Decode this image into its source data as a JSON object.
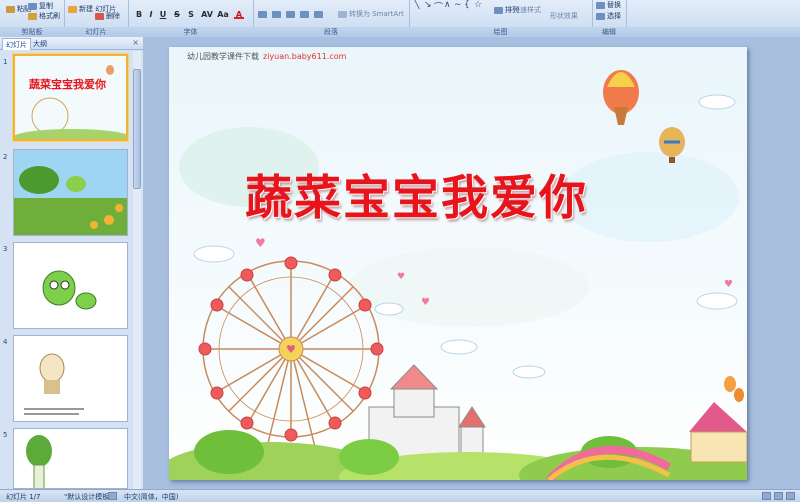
{
  "ribbon": {
    "clipboard": {
      "paste": "粘贴",
      "copy": "复制",
      "format_painter": "格式刷",
      "label": "剪贴板"
    },
    "slides": {
      "new_slide": "新建\n幻灯片",
      "delete": "删除",
      "label": "幻灯片"
    },
    "font": {
      "bold": "B",
      "italic": "I",
      "underline": "U",
      "strike": "S",
      "shadow": "S",
      "spacing": "AV",
      "case": "Aa",
      "color": "A",
      "label": "字体"
    },
    "paragraph": {
      "smartart": "转换为 SmartArt",
      "text_dir": "文字方向",
      "label": "段落"
    },
    "drawing": {
      "arrange": "排列",
      "quick_styles": "快速样式",
      "shape_effects": "形状效果",
      "label": "绘图"
    },
    "editing": {
      "find": "替换",
      "select": "选择",
      "label": "编辑"
    }
  },
  "panel": {
    "tab_slides": "幻灯片",
    "tab_outline": "大纲",
    "close": "×",
    "thumbnails": [
      {
        "num": "1",
        "title": "蔬菜宝宝我爱你"
      },
      {
        "num": "2",
        "title": ""
      },
      {
        "num": "3",
        "title": ""
      },
      {
        "num": "4",
        "title": ""
      },
      {
        "num": "5",
        "title": ""
      }
    ]
  },
  "slide": {
    "site_name": "幼儿园教学课件下载",
    "site_url": "ziyuan.baby611.com",
    "title": "蔬菜宝宝我爱你"
  },
  "status": {
    "slide_count": "幻灯片 1/7",
    "theme": "\"默认设计模板\"",
    "language": "中文(简体，中国)"
  },
  "colors": {
    "title": "#e8141c",
    "ribbon": "#dce8f6",
    "panel": "#d5e2f3",
    "selected_border": "#f3b03a"
  }
}
